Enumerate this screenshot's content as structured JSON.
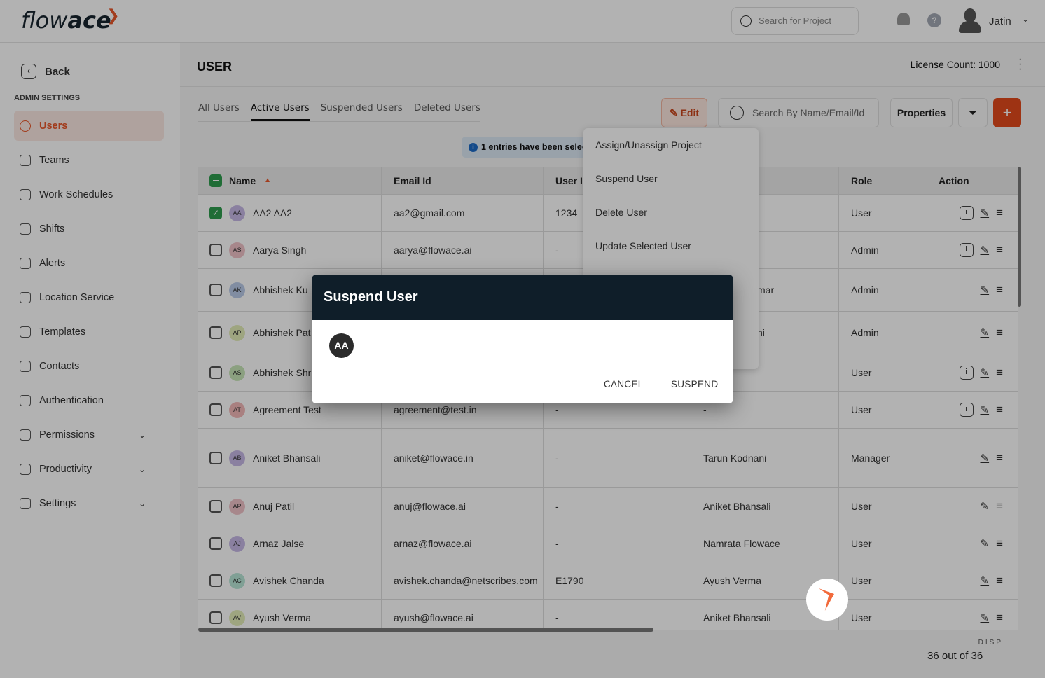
{
  "app": {
    "logo_text": "flowace",
    "search_placeholder": "Search for Project",
    "user_name": "Jatin"
  },
  "sidebar": {
    "back": "Back",
    "section": "ADMIN SETTINGS",
    "items": [
      {
        "label": "Users",
        "active": true
      },
      {
        "label": "Teams"
      },
      {
        "label": "Work Schedules"
      },
      {
        "label": "Shifts"
      },
      {
        "label": "Alerts"
      },
      {
        "label": "Location Service"
      },
      {
        "label": "Templates"
      },
      {
        "label": "Contacts"
      },
      {
        "label": "Authentication"
      },
      {
        "label": "Permissions",
        "expandable": true
      },
      {
        "label": "Productivity",
        "expandable": true
      },
      {
        "label": "Settings",
        "expandable": true
      }
    ]
  },
  "main": {
    "title": "USER",
    "license": "License Count: 1000",
    "tabs": [
      "All Users",
      "Active Users",
      "Suspended Users",
      "Deleted Users"
    ],
    "active_tab": "Active Users",
    "toolbar": {
      "edit": "Edit",
      "search_placeholder": "Search By Name/Email/Id",
      "properties": "Properties",
      "add": "+"
    },
    "info": "1 entries have been selected",
    "table": {
      "headers": [
        "Name",
        "Email Id",
        "User I",
        "",
        "Role",
        "Action"
      ],
      "rows": [
        {
          "initials": "AA",
          "name": "AA2 AA2",
          "email": "aa2@gmail.com",
          "uid": "1234",
          "mgr": "",
          "role": "User",
          "checked": true,
          "info": true,
          "color": "#c6b8e6"
        },
        {
          "initials": "AS",
          "name": "Aarya Singh",
          "email": "aarya@flowace.ai",
          "uid": "-",
          "mgr": "",
          "role": "Admin",
          "info": true,
          "color": "#f0c2c8"
        },
        {
          "initials": "AK",
          "name": "Abhishek Ku",
          "email": "",
          "uid": "",
          "mgr": "mar",
          "role": "Admin",
          "color": "#b9cbe8"
        },
        {
          "initials": "AP",
          "name": "Abhishek Pat",
          "email": "",
          "uid": "",
          "mgr": "ni",
          "role": "Admin",
          "color": "#e3ecb8"
        },
        {
          "initials": "AS",
          "name": "Abhishek Shri",
          "email": "",
          "uid": "",
          "mgr": "",
          "role": "User",
          "info": true,
          "color": "#c8e6b8"
        },
        {
          "initials": "AT",
          "name": "Agreement Test",
          "email": "agreement@test.in",
          "uid": "-",
          "mgr": "-",
          "role": "User",
          "info": true,
          "color": "#f2b8b8"
        },
        {
          "initials": "AB",
          "name": "Aniket Bhansali",
          "email": "aniket@flowace.in",
          "uid": "-",
          "mgr": "Tarun Kodnani",
          "role": "Manager",
          "color": "#c6b8e6"
        },
        {
          "initials": "AP",
          "name": "Anuj Patil",
          "email": "anuj@flowace.ai",
          "uid": "-",
          "mgr": "Aniket Bhansali",
          "role": "User",
          "color": "#f0c2c8"
        },
        {
          "initials": "AJ",
          "name": "Arnaz Jalse",
          "email": "arnaz@flowace.ai",
          "uid": "-",
          "mgr": "Namrata Flowace",
          "role": "User",
          "color": "#c6b8e6"
        },
        {
          "initials": "AC",
          "name": "Avishek Chanda",
          "email": "avishek.chanda@netscribes.com",
          "uid": "E1790",
          "mgr": "Ayush Verma",
          "role": "User",
          "color": "#b8e6d6"
        },
        {
          "initials": "AV",
          "name": "Ayush Verma",
          "email": "ayush@flowace.ai",
          "uid": "-",
          "mgr": "Aniket Bhansali",
          "role": "User",
          "color": "#e3ecb8"
        }
      ]
    },
    "footer": {
      "display_label": "DISP",
      "count": "36 out of 36 r"
    }
  },
  "dropdown": [
    "Assign/Unassign Project",
    "Suspend User",
    "Delete User",
    "Update Selected User"
  ],
  "modal": {
    "title": "Suspend User",
    "avatar": "AA",
    "cancel": "CANCEL",
    "confirm": "SUSPEND"
  }
}
